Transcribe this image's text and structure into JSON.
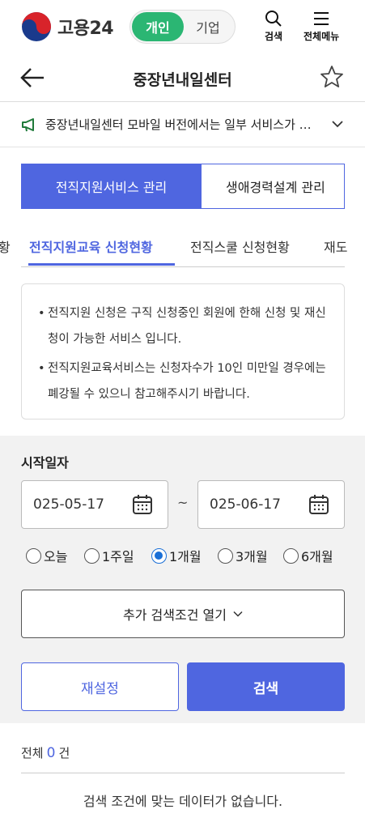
{
  "header": {
    "logo_text": "고용24",
    "toggle": {
      "personal": "개인",
      "company": "기업"
    },
    "search_label": "검색",
    "menu_label": "전체메뉴"
  },
  "titlebar": {
    "title": "중장년내일센터"
  },
  "notice": {
    "text": "중장년내일센터 모바일 버전에서는 일부 서비스가 제한될 수 있습니다."
  },
  "main_tabs": [
    {
      "label": "전직지원서비스 관리"
    },
    {
      "label": "생애경력설계 관리"
    }
  ],
  "sub_tabs": [
    {
      "label": "황"
    },
    {
      "label": "전직지원교육 신청현황"
    },
    {
      "label": "전직스쿨 신청현황"
    },
    {
      "label": "재도"
    }
  ],
  "info": {
    "items": [
      "전직지원 신청은 구직 신청중인 회원에 한해 신청 및 재신청이 가능한 서비스 입니다.",
      "전직지원교육서비스는 신청자수가 10인 미만일 경우에는 폐강될 수 있으니 참고해주시기 바랍니다."
    ]
  },
  "search": {
    "label": "시작일자",
    "start_date": "025-05-17",
    "end_date": "025-06-17",
    "separator": "~",
    "periods": [
      "오늘",
      "1주일",
      "1개월",
      "3개월",
      "6개월"
    ],
    "selected_period": "1개월",
    "more_label": "추가 검색조건 열기",
    "reset_label": "재설정",
    "search_label": "검색"
  },
  "results": {
    "total_label": "전체",
    "total_count": "0",
    "unit": "건",
    "empty_message": "검색 조건에 맞는 데이터가 없습니다."
  },
  "colors": {
    "primary": "#4f66e0",
    "toggle_on": "#2bb673",
    "radio": "#1a6fd6"
  }
}
